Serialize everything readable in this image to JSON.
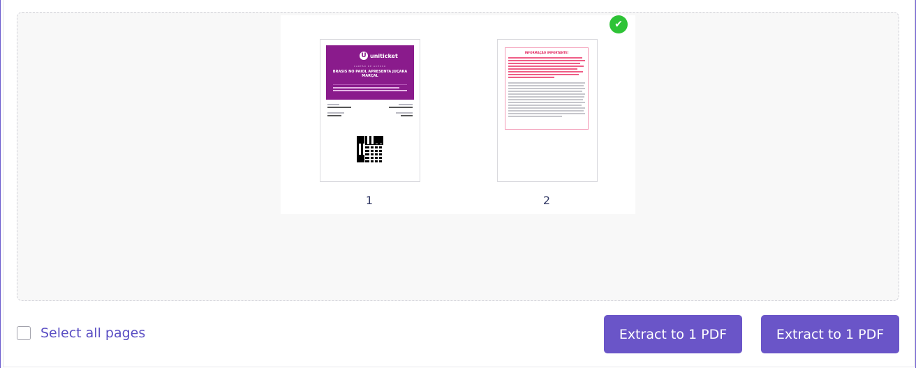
{
  "preview": {
    "selected_badge_icon": "check-icon",
    "pages": [
      {
        "number": "1",
        "ticket": {
          "brand": "uniticket",
          "subtitle": "CARTÃO DE ACESSO",
          "event_title": "BRASIS NO PAIOL APRESENTA JUÇARA MARÇAL"
        }
      },
      {
        "number": "2",
        "info": {
          "title": "INFORMAÇÃO IMPORTANTE!"
        }
      }
    ]
  },
  "footer": {
    "select_all_label": "Select all pages",
    "select_all_checked": false,
    "extract_button_1": "Extract to 1 PDF",
    "extract_button_2": "Extract to 1 PDF"
  },
  "colors": {
    "accent": "#6a55c8",
    "success": "#2ec336",
    "ticket_header": "#8a1b8c",
    "warning_text": "#e0245e"
  }
}
